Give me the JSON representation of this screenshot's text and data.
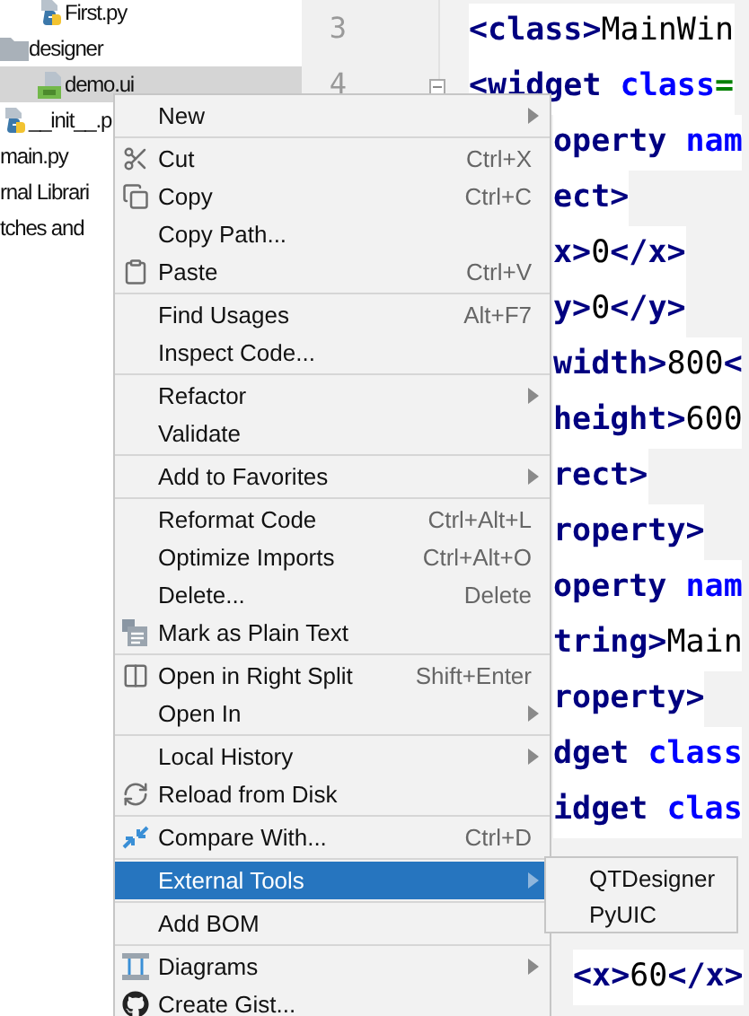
{
  "project_tree": [
    {
      "children": [
        {
          "label": "First.py",
          "kind": "python",
          "selected": false
        }
      ]
    },
    {
      "label": "designer",
      "kind": "folder",
      "selected": false,
      "children": [
        {
          "label": "demo.ui",
          "kind": "qt",
          "selected": true
        }
      ]
    },
    {
      "label": "__init__.p",
      "kind": "python",
      "selected": false
    },
    {
      "label": "main.py",
      "kind": "plain",
      "selected": false
    },
    {
      "label": "rnal Librari",
      "kind": "plain",
      "selected": false
    },
    {
      "label": "tches and",
      "kind": "plain",
      "selected": false
    }
  ],
  "gutter": {
    "line_numbers": [
      "3",
      "4"
    ]
  },
  "editor": {
    "lines": [
      {
        "covered": false,
        "segments": [
          {
            "kind": "tag",
            "text": "<class>"
          },
          {
            "kind": "text",
            "text": "MainWin"
          }
        ]
      },
      {
        "covered": false,
        "segments": [
          {
            "kind": "tag",
            "text": "<widget "
          },
          {
            "kind": "attr",
            "text": "class"
          },
          {
            "kind": "eq",
            "text": "="
          }
        ]
      },
      {
        "covered": true,
        "segments": [
          {
            "kind": "tag",
            "text": "operty "
          },
          {
            "kind": "attr",
            "text": "nam"
          }
        ]
      },
      {
        "covered": true,
        "segments": [
          {
            "kind": "tag",
            "text": "ect>"
          }
        ]
      },
      {
        "covered": true,
        "segments": [
          {
            "kind": "tag",
            "text": "x>"
          },
          {
            "kind": "text",
            "text": "0"
          },
          {
            "kind": "tag",
            "text": "</x>"
          }
        ]
      },
      {
        "covered": true,
        "segments": [
          {
            "kind": "tag",
            "text": "y>"
          },
          {
            "kind": "text",
            "text": "0"
          },
          {
            "kind": "tag",
            "text": "</y>"
          }
        ]
      },
      {
        "covered": true,
        "segments": [
          {
            "kind": "tag",
            "text": "width>"
          },
          {
            "kind": "text",
            "text": "800"
          },
          {
            "kind": "tag",
            "text": "<"
          }
        ]
      },
      {
        "covered": true,
        "segments": [
          {
            "kind": "tag",
            "text": "height>"
          },
          {
            "kind": "text",
            "text": "600"
          }
        ]
      },
      {
        "covered": true,
        "segments": [
          {
            "kind": "tag",
            "text": "rect>"
          }
        ]
      },
      {
        "covered": true,
        "segments": [
          {
            "kind": "tag",
            "text": "roperty>"
          }
        ]
      },
      {
        "covered": true,
        "segments": [
          {
            "kind": "tag",
            "text": "operty "
          },
          {
            "kind": "attr",
            "text": "nam"
          }
        ]
      },
      {
        "covered": true,
        "segments": [
          {
            "kind": "tag",
            "text": "tring>"
          },
          {
            "kind": "text",
            "text": "Main"
          }
        ]
      },
      {
        "covered": true,
        "segments": [
          {
            "kind": "tag",
            "text": "roperty>"
          }
        ]
      },
      {
        "covered": true,
        "segments": [
          {
            "kind": "tag",
            "text": "dget "
          },
          {
            "kind": "attr",
            "text": "class"
          }
        ]
      },
      {
        "covered": true,
        "segments": [
          {
            "kind": "tag",
            "text": "idget "
          },
          {
            "kind": "attr",
            "text": "clas"
          }
        ]
      },
      {
        "segments": [
          {
            "kind": "tag",
            "text": "<x>"
          },
          {
            "kind": "text",
            "text": "60"
          },
          {
            "kind": "tag",
            "text": "</x>"
          }
        ]
      }
    ]
  },
  "context_menu": {
    "groups": [
      [
        {
          "label": "New",
          "submenu": true,
          "selected": false
        }
      ],
      [
        {
          "label": "Cut",
          "shortcut": "Ctrl+X",
          "submenu": false,
          "selected": false
        },
        {
          "label": "Copy",
          "shortcut": "Ctrl+C",
          "submenu": false,
          "selected": false
        },
        {
          "label": "Copy Path...",
          "submenu": false,
          "selected": false
        },
        {
          "label": "Paste",
          "shortcut": "Ctrl+V",
          "submenu": false,
          "selected": false
        }
      ],
      [
        {
          "label": "Find Usages",
          "shortcut": "Alt+F7",
          "submenu": false,
          "selected": false
        },
        {
          "label": "Inspect Code...",
          "submenu": false,
          "selected": false
        }
      ],
      [
        {
          "label": "Refactor",
          "submenu": true,
          "selected": false
        },
        {
          "label": "Validate",
          "submenu": false,
          "selected": false
        }
      ],
      [
        {
          "label": "Add to Favorites",
          "submenu": true,
          "selected": false
        }
      ],
      [
        {
          "label": "Reformat Code",
          "shortcut": "Ctrl+Alt+L",
          "submenu": false,
          "selected": false
        },
        {
          "label": "Optimize Imports",
          "shortcut": "Ctrl+Alt+O",
          "submenu": false,
          "selected": false
        },
        {
          "label": "Delete...",
          "shortcut": "Delete",
          "submenu": false,
          "selected": false
        },
        {
          "label": "Mark as Plain Text",
          "submenu": false,
          "selected": false
        }
      ],
      [
        {
          "label": "Open in Right Split",
          "shortcut": "Shift+Enter",
          "submenu": false,
          "selected": false
        },
        {
          "label": "Open In",
          "submenu": true,
          "selected": false
        }
      ],
      [
        {
          "label": "Local History",
          "submenu": true,
          "selected": false
        },
        {
          "label": "Reload from Disk",
          "submenu": false,
          "selected": false
        }
      ],
      [
        {
          "label": "Compare With...",
          "shortcut": "Ctrl+D",
          "submenu": false,
          "selected": false
        }
      ],
      [
        {
          "label": "External Tools",
          "submenu": true,
          "selected": true
        }
      ],
      [
        {
          "label": "Add BOM",
          "submenu": false,
          "selected": false
        }
      ],
      [
        {
          "label": "Diagrams",
          "submenu": true,
          "selected": false
        },
        {
          "label": "Create Gist...",
          "submenu": false,
          "selected": false
        }
      ]
    ]
  },
  "submenu": {
    "items": [
      {
        "label": "QTDesigner",
        "selected": false
      },
      {
        "label": "PyUIC",
        "selected": false
      }
    ]
  }
}
